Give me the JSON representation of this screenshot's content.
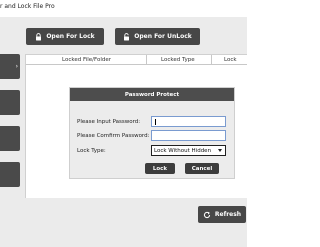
{
  "window": {
    "title": "r and Lock File Pro"
  },
  "toolbar": {
    "open_for_lock_label": "Open For Lock",
    "open_for_unlock_label": "Open For UnLock"
  },
  "sidebar": {
    "items": [
      {
        "label": ""
      },
      {
        "label": ""
      },
      {
        "label": ""
      },
      {
        "label": ""
      }
    ]
  },
  "table": {
    "columns": [
      "Locked File/Folder",
      "Locked Type",
      "Lock"
    ]
  },
  "dialog": {
    "title": "Password Protect",
    "input_password_label": "Please Input Password:",
    "confirm_password_label": "Please Comfirm Password:",
    "lock_type_label": "Lock Type:",
    "lock_type_value": "Lock Without Hidden",
    "lock_button": "Lock",
    "cancel_button": "Cancel"
  },
  "footer": {
    "refresh_label": "Refresh"
  },
  "colors": {
    "button_dark": "#474747",
    "dialog_header": "#4d4d4d",
    "input_border": "#7a9bd0"
  }
}
